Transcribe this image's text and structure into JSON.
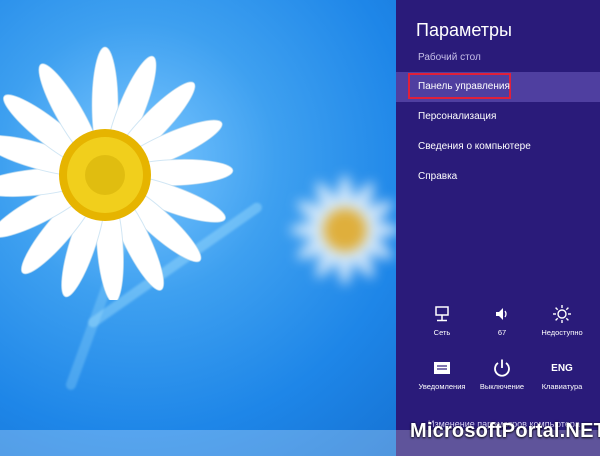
{
  "settings": {
    "title": "Параметры",
    "subtitle": "Рабочий стол",
    "menu": [
      {
        "label": "Панель управления",
        "selected": true
      },
      {
        "label": "Персонализация",
        "selected": false
      },
      {
        "label": "Сведения о компьютере",
        "selected": false
      },
      {
        "label": "Справка",
        "selected": false
      }
    ],
    "tiles": [
      {
        "icon": "network-icon",
        "label": "Сеть"
      },
      {
        "icon": "volume-icon",
        "label": "67"
      },
      {
        "icon": "brightness-icon",
        "label": "Недоступно"
      },
      {
        "icon": "notifications-icon",
        "label": "Уведомления"
      },
      {
        "icon": "power-icon",
        "label": "Выключение"
      },
      {
        "icon": "keyboard-icon",
        "label": "Клавиатура",
        "glyph": "ENG"
      }
    ],
    "bottom_link": "Изменение параметров компьютера"
  },
  "watermark": "MicrosoftPortal.NET",
  "colors": {
    "charm_bg": "#2a1b7a",
    "selected_bg": "#4f3fa0",
    "highlight_border": "#e0203a",
    "wallpaper": "#1e86e8"
  }
}
